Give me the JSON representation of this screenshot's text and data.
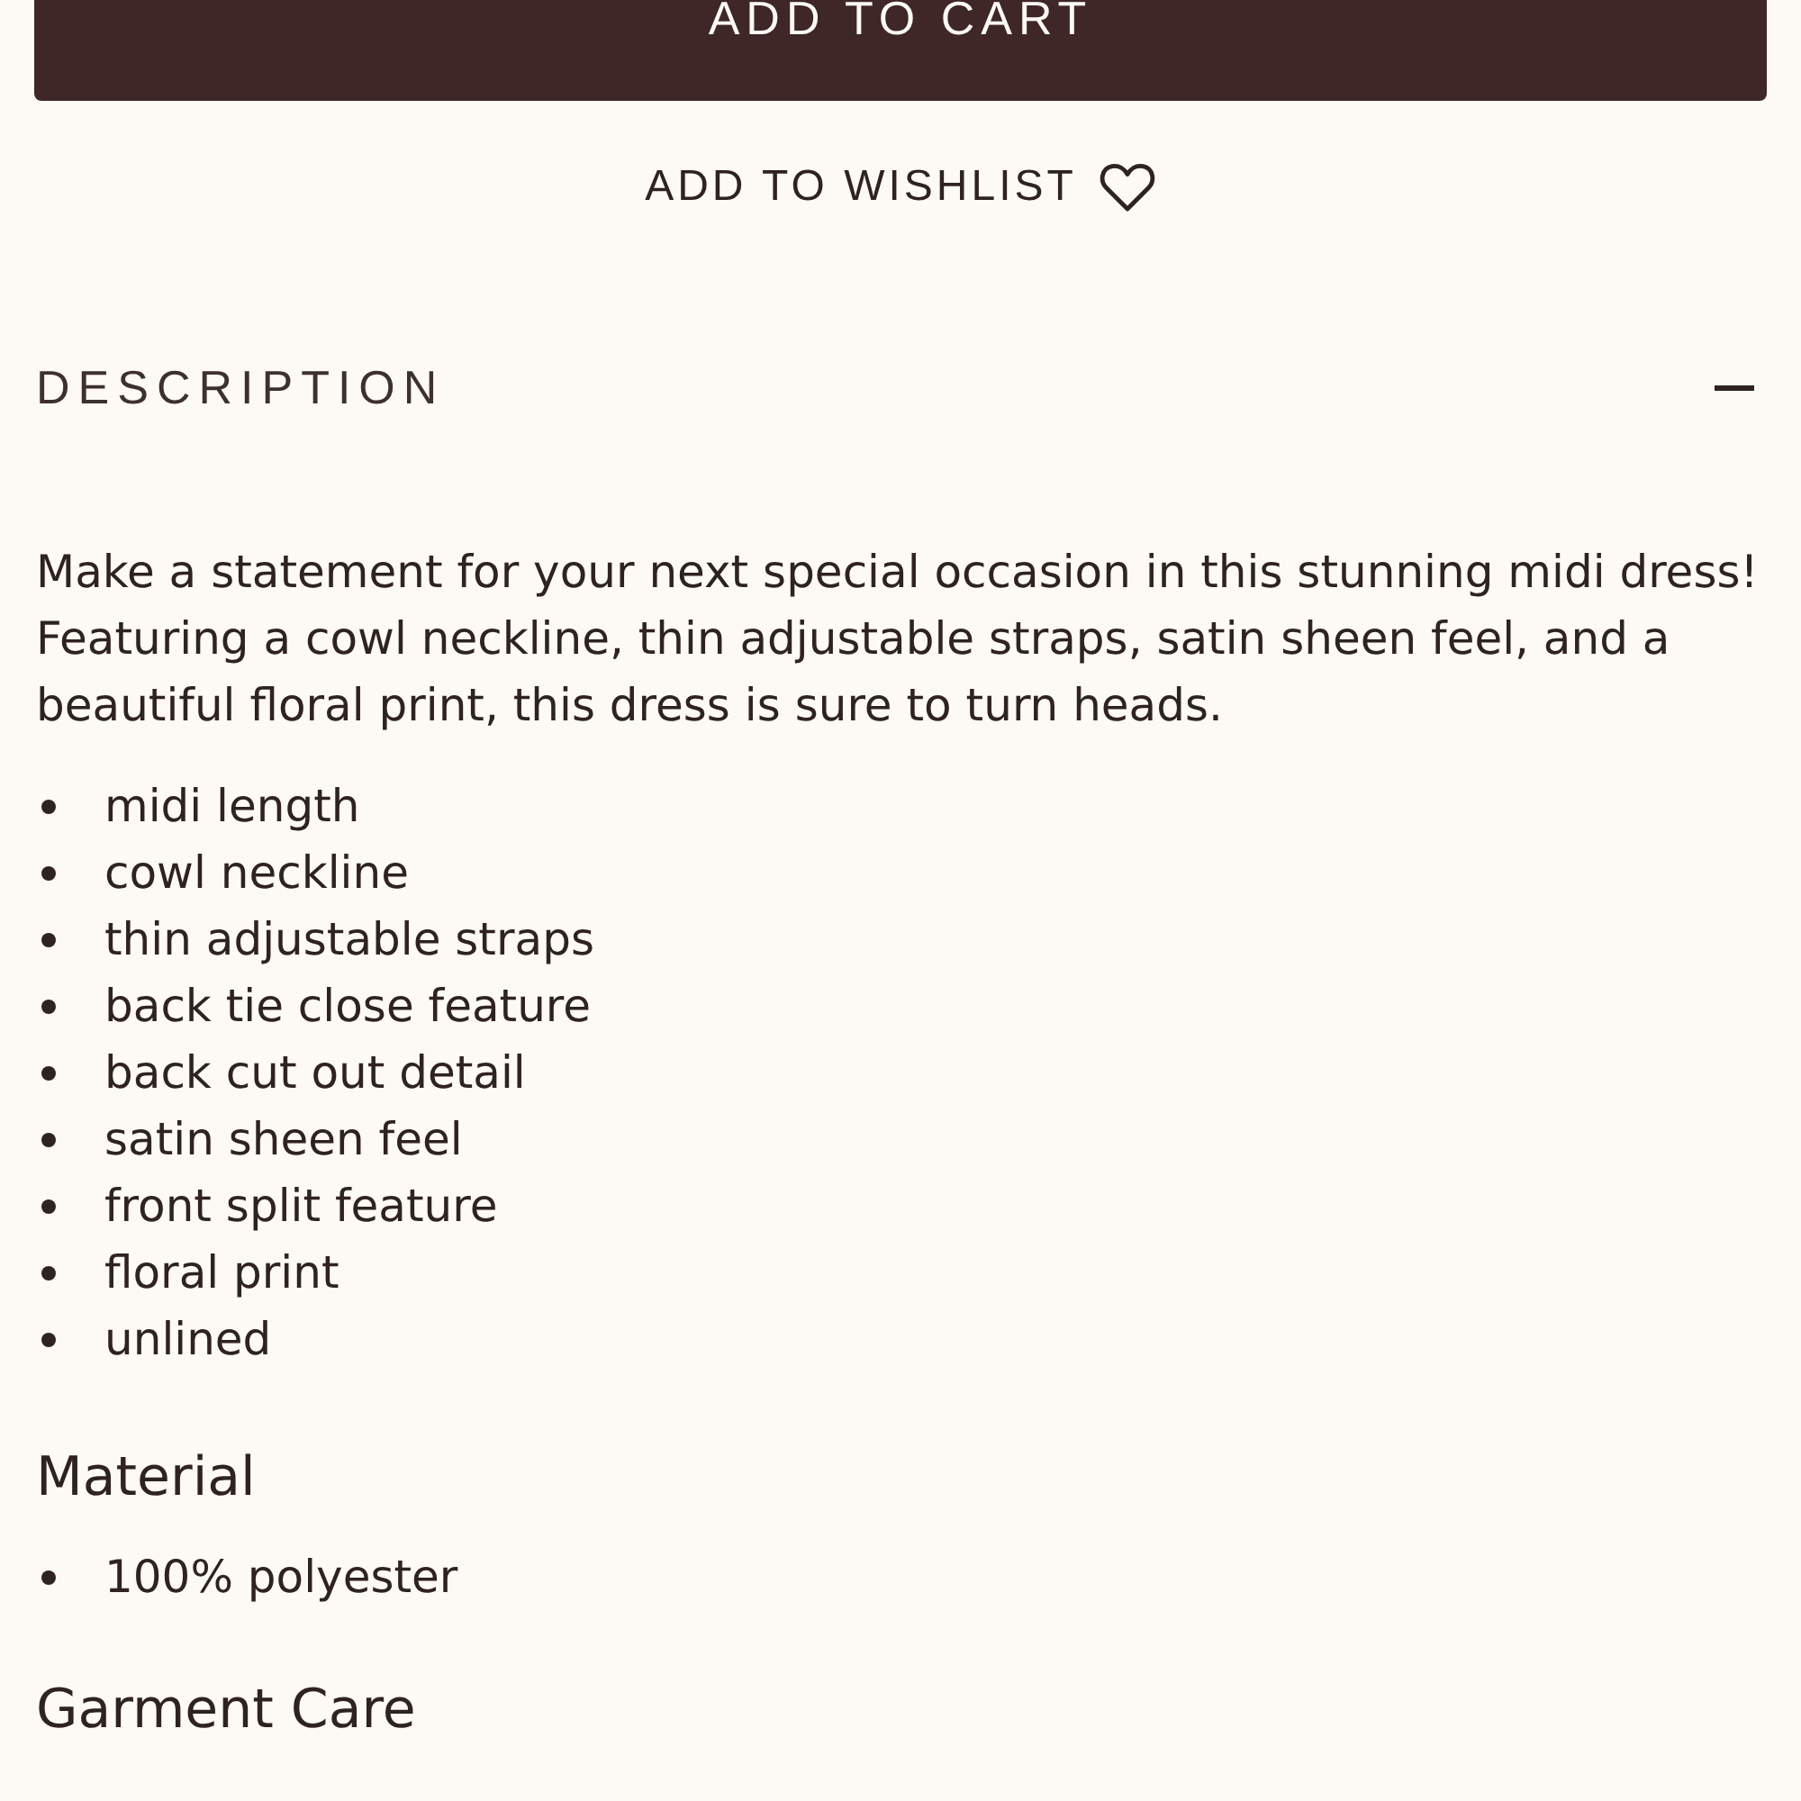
{
  "add_to_cart": "ADD TO CART",
  "add_to_wishlist": "ADD TO WISHLIST",
  "accordion": {
    "title": "DESCRIPTION",
    "expanded": true,
    "text": "Make a statement for your next special occasion in this stunning midi dress! Featuring a cowl neckline, thin adjustable straps, satin sheen feel, and a beautiful floral print, this dress is sure to turn heads.",
    "features": [
      "midi length",
      "cowl neckline",
      "thin adjustable straps",
      "back tie close feature",
      "back cut out detail",
      "satin sheen feel",
      "front split feature",
      "floral print",
      "unlined"
    ],
    "sections": [
      {
        "heading": "Material",
        "items": [
          "100% polyester"
        ]
      },
      {
        "heading": "Garment Care"
      }
    ]
  }
}
